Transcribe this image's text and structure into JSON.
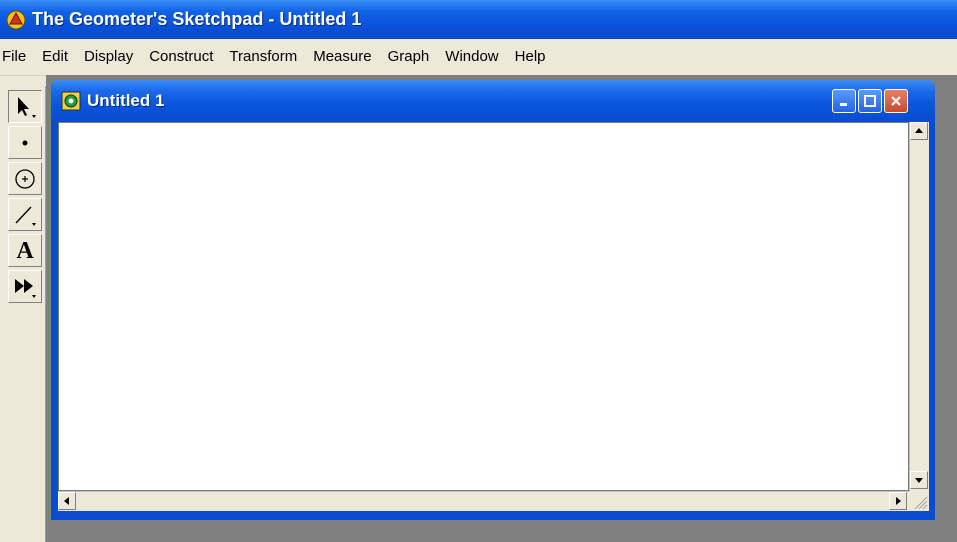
{
  "app": {
    "title": "The Geometer's Sketchpad - Untitled 1",
    "icon": "sketchpad-app-icon"
  },
  "menu": {
    "items": [
      {
        "label": "File"
      },
      {
        "label": "Edit"
      },
      {
        "label": "Display"
      },
      {
        "label": "Construct"
      },
      {
        "label": "Transform"
      },
      {
        "label": "Measure"
      },
      {
        "label": "Graph"
      },
      {
        "label": "Window"
      },
      {
        "label": "Help"
      }
    ]
  },
  "toolbox": {
    "tools": [
      {
        "name": "selection-arrow-tool",
        "icon": "arrow-icon",
        "active": true
      },
      {
        "name": "point-tool",
        "icon": "point-icon",
        "active": false
      },
      {
        "name": "compass-tool",
        "icon": "circle-icon",
        "active": false
      },
      {
        "name": "straightedge-tool",
        "icon": "segment-icon",
        "active": false
      },
      {
        "name": "text-tool",
        "icon": "text-a-icon",
        "label": "A",
        "active": false
      },
      {
        "name": "custom-tool",
        "icon": "fast-forward-icon",
        "active": false
      }
    ]
  },
  "document": {
    "title": "Untitled 1",
    "icon": "sketch-document-icon"
  },
  "colors": {
    "titlebar": "#0a55dc",
    "workspace": "#808080",
    "face": "#ece9d8",
    "close": "#c84a2c"
  }
}
